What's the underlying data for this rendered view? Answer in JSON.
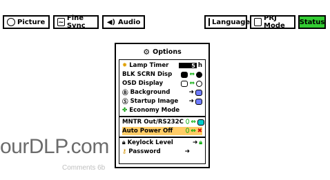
{
  "tabs": [
    {
      "label": "Picture"
    },
    {
      "label": "Fine Sync"
    },
    {
      "label": "Audio"
    },
    {
      "label": "Language"
    },
    {
      "label": "PRJ Mode"
    },
    {
      "label": "Status"
    }
  ],
  "menu": {
    "title": "Options",
    "items": [
      {
        "label": "Lamp Timer",
        "value": "5",
        "unit": "h"
      },
      {
        "label": "BLK SCRN Disp"
      },
      {
        "label": "OSD Display"
      },
      {
        "label": "Background"
      },
      {
        "label": "Startup Image"
      },
      {
        "label": "Economy Mode"
      },
      {
        "label": "MNTR Out/RS232C"
      },
      {
        "label": "Auto Power Off"
      },
      {
        "label": "Keylock Level"
      },
      {
        "label": "Password"
      }
    ]
  },
  "watermark": {
    "text": "ourDLP.com",
    "sub": "Comments 6b"
  },
  "colors": {
    "active_tab": "#33cc33",
    "highlight": "#ffcc66",
    "blue_chip": "#6f7cff"
  }
}
